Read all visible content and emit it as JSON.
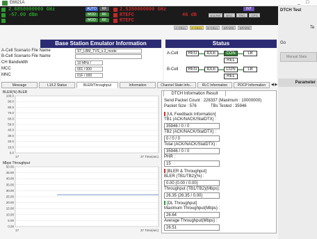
{
  "window": {
    "title": "E6621A",
    "min": "_",
    "close": "□"
  },
  "freq_panel": {
    "row1": {
      "left": "2.6850000000 GHz",
      "left_lv": "-57.00 dBm",
      "right": "2.5350000000 GHz",
      "right_lv": "46 dB"
    },
    "row2": {
      "left": "",
      "right": "RTEFC"
    },
    "row3": {
      "left": "",
      "right": "RTEFC"
    },
    "leds1": [
      "AUTO",
      "RF",
      "MOD",
      "RF"
    ],
    "leds2": [
      "MOD",
      "RF"
    ],
    "leds3": [
      "MOD",
      "RF"
    ],
    "right_leds": [
      "INT",
      "AUTO"
    ],
    "grey_btns": [
      "Ext.Ref",
      "BNC",
      "TRG",
      "GPS"
    ],
    "grey_btns2": [
      "A-CELL",
      "B-CELL",
      "SPARE",
      "SPARE"
    ]
  },
  "bse": {
    "title": "Base Station Emulator Information",
    "rows": [
      {
        "label": "A-Cell Scenario File Name",
        "value": "ST_LBM_TVS_s.3_mode"
      },
      {
        "label": "B-Cell Scenario File Name",
        "value": ""
      },
      {
        "label": "CH Bandwidth",
        "value": "10 MHz /"
      },
      {
        "label": "MCC",
        "value": "001 / 000"
      },
      {
        "label": "MNC",
        "value": "01F / 000"
      }
    ]
  },
  "status": {
    "title": "Status",
    "acell": "A-Cell",
    "bcell": "B-Cell",
    "states": [
      "REG",
      "IDLE",
      "CON",
      "LB",
      "REL"
    ]
  },
  "tabs": [
    "Message",
    "L1/L2 Status",
    "BLER/Throughput",
    "Information",
    "Channel State Info...",
    "RLC Information",
    "PDCP Information"
  ],
  "tab_arrows": "◀ ▶",
  "chart_data": [
    {
      "type": "line",
      "title": "BLER(%) BLER",
      "ylim": [
        0,
        100
      ],
      "yticks": [
        "100.0",
        "90.0",
        "80.0",
        "70.0",
        "60.0",
        "50.0",
        "40.0",
        "30.0",
        "20.0",
        "10.0",
        "0.0"
      ],
      "xlabel_left": "17",
      "xlabel_right": "37 Time(sec)",
      "series": [
        {
          "values": []
        }
      ]
    },
    {
      "type": "line",
      "title": "Mbps Throughput",
      "ylim": [
        0,
        50
      ],
      "yticks": [
        "50.00",
        "45.00",
        "40.00",
        "35.00",
        "30.00",
        "25.00",
        "20.00",
        "15.00",
        "10.00",
        "5.00",
        "0.00"
      ],
      "xlabel_left": "17",
      "xlabel_right": "37 Time(sec)",
      "series": [
        {
          "x": [
            0,
            4,
            8,
            12,
            16,
            20
          ],
          "values": [
            26.35,
            26.35,
            26.35,
            26.35,
            26.35,
            26.35
          ]
        },
        {
          "x": [
            0,
            4,
            8,
            12,
            16,
            20
          ],
          "values": [
            26.35,
            26.35,
            26.35,
            26.35,
            26.35,
            26.35
          ]
        }
      ],
      "colors": [
        "#c04040",
        "#3a7ad0"
      ]
    }
  ],
  "dtch": {
    "tab": "DTCH Information Result",
    "send_count": "Send Packet Count : 228337 (Maximum : 10000000)",
    "packet_size": "Packet Size : 576",
    "tbs": "TBs Tested : 35946",
    "ul_feedback": "[UL Feedback Information]",
    "tb1_label": "TB1 (ACK/NACK/StatDTX) :",
    "tb1_val": "35946 / 0 / 0",
    "tb2_label": "TB2 (ACK/NACK/StatDTX) :",
    "tb2_val": "0 / 0 / 0",
    "total_label": "Total (ACK/NACK/StatDTX) :",
    "total_val": "35946 / 0 / 0",
    "phr_label": "PHR :",
    "phr_val": "15",
    "bler_sec": "[BLER & Throughput]",
    "bler_label": "BLER (TB1/TB2)(%) :",
    "bler_val": "0.00 (0.00 / 0.00)",
    "thr_label": "Throughput (TB1/TB2)(Mbps):",
    "thr_val": "26.35 (26.35 / 0.00)",
    "dl_sec": "[DL Throughput]",
    "max_label": "Maximum Throughput(Mbps) :",
    "max_val": "26.64",
    "avg_label": "Average Throughput(Mbps) :",
    "avg_val": "26.51"
  },
  "right": {
    "title": "DTCH Test",
    "item1": "Te",
    "item2": "Go",
    "item3": "Manual Statu",
    "item4": "Parameter"
  },
  "colors": {
    "header": "#2b2b73",
    "con": "#2e7d2e",
    "green_text": "#2e9a2e",
    "red_text": "#c02a2a"
  }
}
